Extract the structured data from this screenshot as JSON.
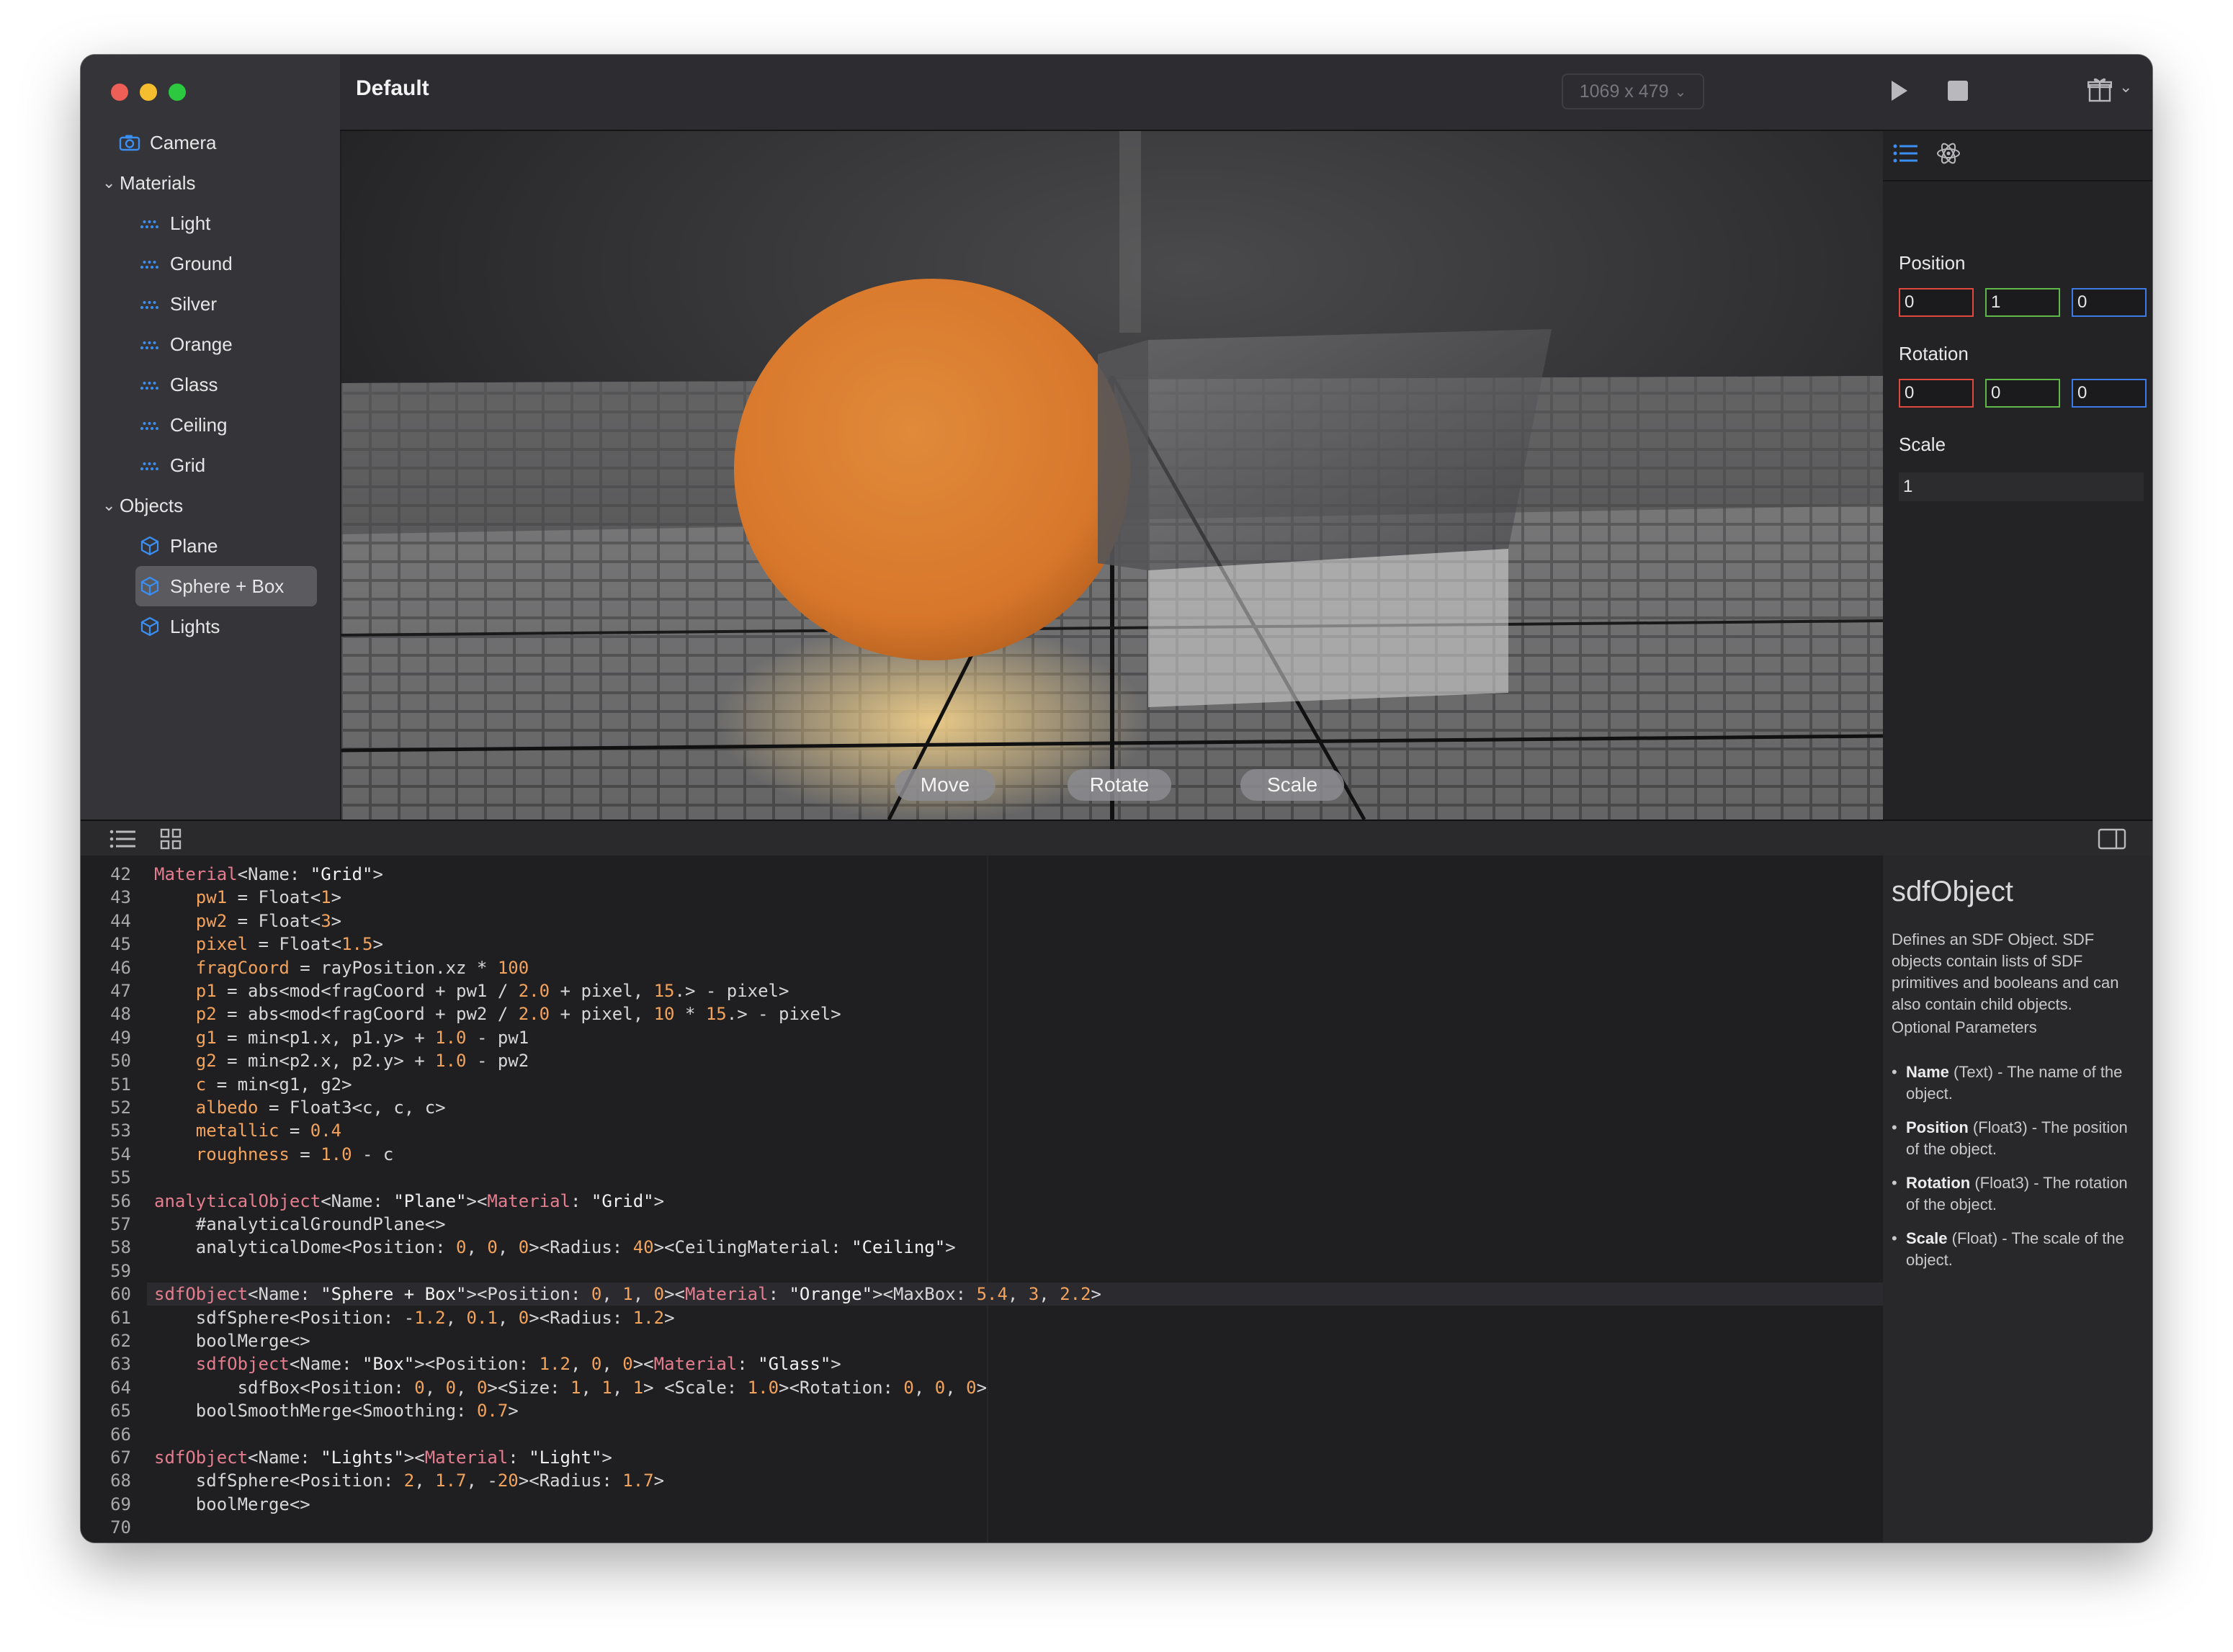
{
  "window": {
    "title": "Default",
    "resolution": "1069 x 479"
  },
  "sidebar": {
    "camera": "Camera",
    "groups": [
      {
        "label": "Materials",
        "items": [
          "Light",
          "Ground",
          "Silver",
          "Orange",
          "Glass",
          "Ceiling",
          "Grid"
        ]
      },
      {
        "label": "Objects",
        "items": [
          "Plane",
          "Sphere + Box",
          "Lights"
        ]
      }
    ],
    "selected": "Sphere + Box"
  },
  "viewport": {
    "buttons": {
      "move": "Move",
      "rotate": "Rotate",
      "scale": "Scale"
    }
  },
  "inspector": {
    "position_label": "Position",
    "position": [
      "0",
      "1",
      "0"
    ],
    "rotation_label": "Rotation",
    "rotation": [
      "0",
      "0",
      "0"
    ],
    "scale_label": "Scale",
    "scale": "1",
    "axis_colors": {
      "x": "#e0473f",
      "y": "#5fb84a",
      "z": "#3c7be6"
    }
  },
  "editor": {
    "first_line": 42,
    "current_line": 60,
    "lines": [
      "Material<Name: \"Grid\">",
      "    pw1 = Float<1>",
      "    pw2 = Float<3>",
      "    pixel = Float<1.5>",
      "    fragCoord = rayPosition.xz * 100",
      "    p1 = abs<mod<fragCoord + pw1 / 2.0 + pixel, 15.> - pixel>",
      "    p2 = abs<mod<fragCoord + pw2 / 2.0 + pixel, 10 * 15.> - pixel>",
      "    g1 = min<p1.x, p1.y> + 1.0 - pw1",
      "    g2 = min<p2.x, p2.y> + 1.0 - pw2",
      "    c = min<g1, g2>",
      "    albedo = Float3<c, c, c>",
      "    metallic = 0.4",
      "    roughness = 1.0 - c",
      "",
      "analyticalObject<Name: \"Plane\"><Material: \"Grid\">",
      "    #analyticalGroundPlane<>",
      "    analyticalDome<Position: 0, 0, 0><Radius: 40><CeilingMaterial: \"Ceiling\">",
      "",
      "sdfObject<Name: \"Sphere + Box\"><Position: 0, 1, 0><Material: \"Orange\"><MaxBox: 5.4, 3, 2.2>",
      "    sdfSphere<Position: -1.2, 0.1, 0><Radius: 1.2>",
      "    boolMerge<>",
      "    sdfObject<Name: \"Box\"><Position: 1.2, 0, 0><Material: \"Glass\">",
      "        sdfBox<Position: 0, 0, 0><Size: 1, 1, 1> <Scale: 1.0><Rotation: 0, 0, 0>",
      "    boolSmoothMerge<Smoothing: 0.7>",
      "",
      "sdfObject<Name: \"Lights\"><Material: \"Light\">",
      "    sdfSphere<Position: 2, 1.7, -20><Radius: 1.7>",
      "    boolMerge<>",
      ""
    ]
  },
  "doc": {
    "title": "sdfObject",
    "description": "Defines an SDF Object. SDF objects contain lists of SDF primitives and booleans and can also contain child objects.",
    "optional_label": "Optional Parameters",
    "params": [
      {
        "name": "Name",
        "desc": " (Text) - The name of the object."
      },
      {
        "name": "Position",
        "desc": " (Float3) - The position of the object."
      },
      {
        "name": "Rotation",
        "desc": " (Float3) - The rotation of the object."
      },
      {
        "name": "Scale",
        "desc": " (Float) - The scale of the object."
      }
    ]
  }
}
